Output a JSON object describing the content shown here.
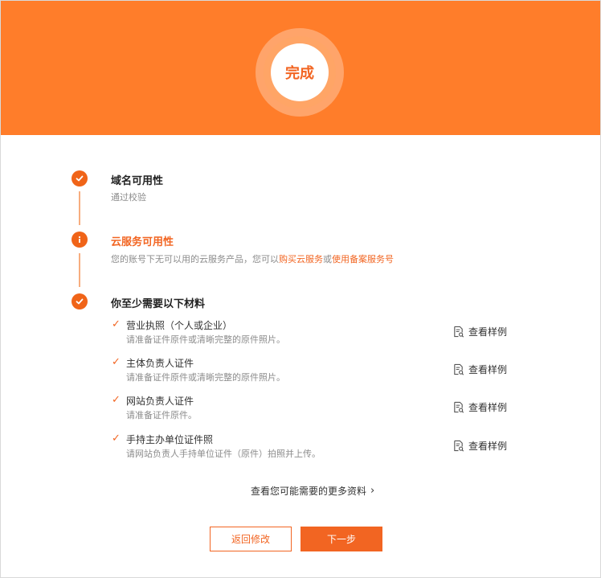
{
  "header": {
    "status_label": "完成",
    "accent_color": "#ff7d2a"
  },
  "steps": [
    {
      "title": "域名可用性",
      "description": "通过校验",
      "status": "success",
      "icon": "check-icon"
    },
    {
      "title": "云服务可用性",
      "description_prefix": "您的账号下无可以用的云服务产品，您可以",
      "link_buy": "购买云服务",
      "connector": "或",
      "link_use": "使用备案服务号",
      "status": "warning",
      "icon": "info-icon"
    },
    {
      "title": "你至少需要以下材料",
      "status": "success",
      "icon": "check-icon"
    }
  ],
  "materials": [
    {
      "title": "营业执照（个人或企业）",
      "description": "请准备证件原件或清晰完整的原件照片。",
      "sample_label": "查看样例"
    },
    {
      "title": "主体负责人证件",
      "description": "请准备证件原件或清晰完整的原件照片。",
      "sample_label": "查看样例"
    },
    {
      "title": "网站负责人证件",
      "description": "请准备证件原件。",
      "sample_label": "查看样例"
    },
    {
      "title": "手持主办单位证件照",
      "description": "请网站负责人手持单位证件（原件）拍照并上传。",
      "sample_label": "查看样例"
    }
  ],
  "more_link": "查看您可能需要的更多资料",
  "buttons": {
    "back": "返回修改",
    "next": "下一步"
  }
}
